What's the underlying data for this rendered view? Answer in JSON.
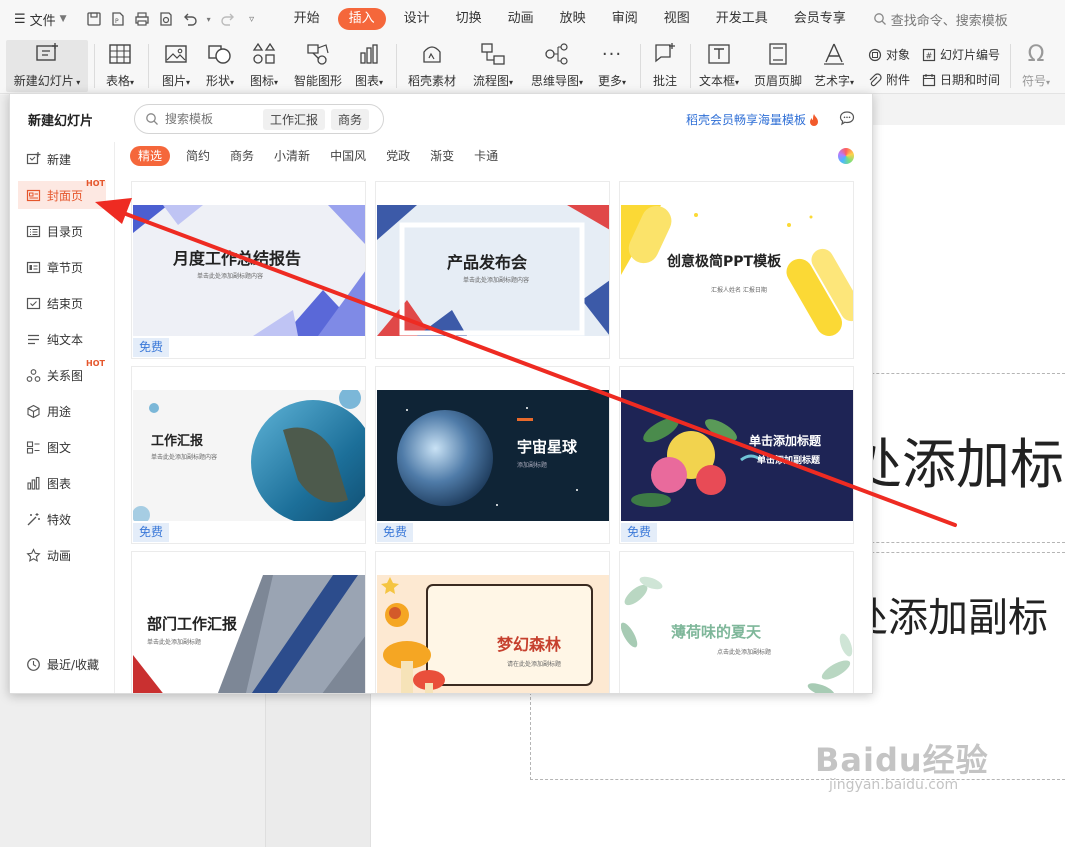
{
  "menubar": {
    "file": "文件",
    "tabs": [
      "开始",
      "插入",
      "设计",
      "切换",
      "动画",
      "放映",
      "审阅",
      "视图",
      "开发工具",
      "会员专享"
    ],
    "active_tab": 1,
    "search": "查找命令、搜索模板"
  },
  "ribbon": {
    "new_slide": "新建幻灯片",
    "table": "表格",
    "picture": "图片",
    "shape": "形状",
    "icon": "图标",
    "smartart": "智能图形",
    "chart": "图表",
    "material": "稻壳素材",
    "flowchart": "流程图",
    "mindmap": "思维导图",
    "more": "更多",
    "comment": "批注",
    "textbox": "文本框",
    "header_footer": "页眉页脚",
    "wordart": "艺术字",
    "object": "对象",
    "slide_number": "幻灯片编号",
    "attachment": "附件",
    "datetime": "日期和时间",
    "symbol": "符号"
  },
  "panel": {
    "title": "新建幻灯片",
    "search_placeholder": "搜索模板",
    "search_chips": [
      "工作汇报",
      "商务"
    ],
    "member_text": "稻壳会员畅享海量模板",
    "hot_badge": "HOT",
    "sidebar": [
      "新建",
      "封面页",
      "目录页",
      "章节页",
      "结束页",
      "纯文本",
      "关系图",
      "用途",
      "图文",
      "图表",
      "特效",
      "动画"
    ],
    "sidebar_recent": "最近/收藏",
    "filters": [
      "精选",
      "简约",
      "商务",
      "小清新",
      "中国风",
      "党政",
      "渐变",
      "卡通"
    ],
    "free_label": "免费",
    "templates": [
      {
        "title": "月度工作总结报告",
        "sub": "单击此处添加副标题内容"
      },
      {
        "title": "产品发布会",
        "sub": "单击此处添加副标题内容"
      },
      {
        "title": "创意极简PPT模板",
        "sub": "汇报人姓名   汇报日期"
      },
      {
        "title": "工作汇报",
        "sub": "单击此处添加副标题内容"
      },
      {
        "title": "宇宙星球",
        "sub": "添加副标题"
      },
      {
        "title": "单击添加标题",
        "sub": "单击添加副标题"
      },
      {
        "title": "部门工作汇报",
        "sub": "单击此处添加副标题"
      },
      {
        "title": "梦幻森林",
        "sub": "请在此处添加副标题"
      },
      {
        "title": "薄荷味的夏天",
        "sub": "点击此处添加副标题"
      }
    ]
  },
  "slide": {
    "title_fragment": "处添加标",
    "subtitle_fragment": "处添加副标"
  },
  "watermark": {
    "main": "Baidu经验",
    "sub": "jingyan.baidu.com"
  },
  "colors": {
    "accent": "#f5673b",
    "link": "#2f6fd6",
    "arrow": "#ee2b22"
  }
}
